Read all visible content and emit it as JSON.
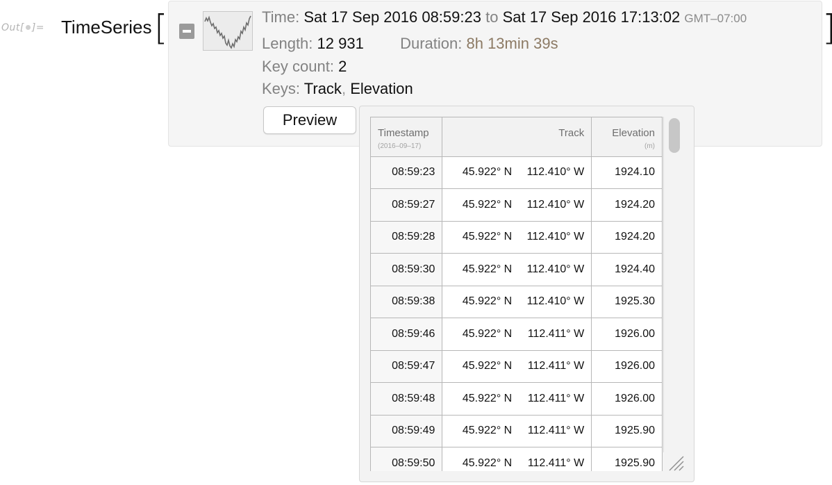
{
  "cell": {
    "out_label_prefix": "Out[",
    "out_label_suffix": "]=",
    "head": "TimeSeries",
    "bracket_open": "[",
    "bracket_close": "]"
  },
  "summary": {
    "thumbnail_icon": "sparkline-icon",
    "time_label": "Time:",
    "time_start": "Sat 17 Sep 2016 08:59:23",
    "time_to": "to",
    "time_end": "Sat 17 Sep 2016 17:13:02",
    "timezone": "GMT–07:00",
    "length_label": "Length:",
    "length_value": "12 931",
    "duration_label": "Duration:",
    "duration_value": "8h 13min 39s",
    "keycount_label": "Key count:",
    "keycount_value": "2",
    "keys_label": "Keys:",
    "key1": "Track",
    "key_sep": ",",
    "key2": "Elevation",
    "preview_label": "Preview"
  },
  "table": {
    "headers": [
      {
        "title": "Timestamp",
        "sub": "(2016–09–17)"
      },
      {
        "title": "Track",
        "sub": ""
      },
      {
        "title": "Elevation",
        "sub": "(m)"
      }
    ],
    "rows": [
      {
        "time": "08:59:23",
        "lat": "45.922° N",
        "lon": "112.410° W",
        "elev": "1924.10"
      },
      {
        "time": "08:59:27",
        "lat": "45.922° N",
        "lon": "112.410° W",
        "elev": "1924.20"
      },
      {
        "time": "08:59:28",
        "lat": "45.922° N",
        "lon": "112.410° W",
        "elev": "1924.20"
      },
      {
        "time": "08:59:30",
        "lat": "45.922° N",
        "lon": "112.410° W",
        "elev": "1924.40"
      },
      {
        "time": "08:59:38",
        "lat": "45.922° N",
        "lon": "112.410° W",
        "elev": "1925.30"
      },
      {
        "time": "08:59:46",
        "lat": "45.922° N",
        "lon": "112.411° W",
        "elev": "1926.00"
      },
      {
        "time": "08:59:47",
        "lat": "45.922° N",
        "lon": "112.411° W",
        "elev": "1926.00"
      },
      {
        "time": "08:59:48",
        "lat": "45.922° N",
        "lon": "112.411° W",
        "elev": "1926.00"
      },
      {
        "time": "08:59:49",
        "lat": "45.922° N",
        "lon": "112.411° W",
        "elev": "1925.90"
      },
      {
        "time": "08:59:50",
        "lat": "45.922° N",
        "lon": "112.411° W",
        "elev": "1925.90"
      }
    ]
  },
  "colors": {
    "label_gray": "#828282",
    "duration_brown": "#8c7a64",
    "panel_bg": "#f5f5f5"
  }
}
